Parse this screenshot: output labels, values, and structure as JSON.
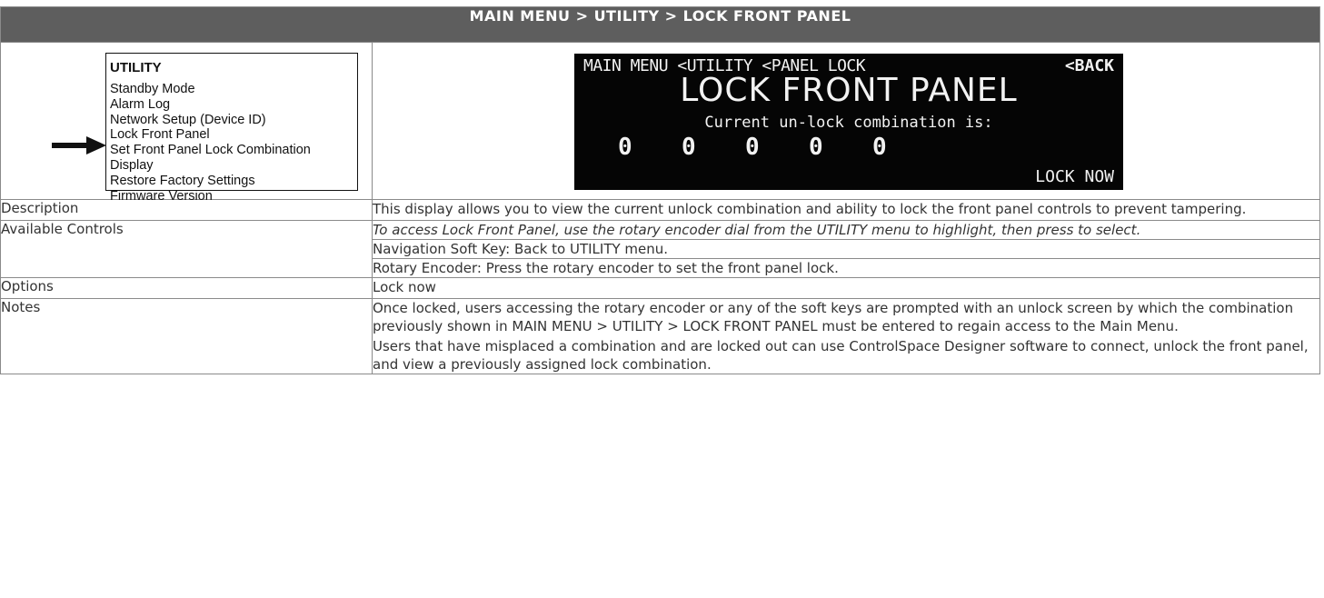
{
  "header": {
    "title": "MAIN MENU > UTILITY > LOCK FRONT PANEL"
  },
  "utility_menu": {
    "title": "UTILITY",
    "items": [
      "Standby Mode",
      "Alarm Log",
      "Network Setup (Device ID)",
      "Lock Front Panel",
      "Set Front Panel Lock Combination",
      "Display",
      "Restore Factory Settings",
      "Firmware Version"
    ],
    "selected_index": 3
  },
  "lcd": {
    "breadcrumb": "MAIN MENU <UTILITY <PANEL LOCK",
    "back_label": "<BACK",
    "title": "LOCK FRONT PANEL",
    "subtitle": "Current un-lock combination is:",
    "combination": [
      "0",
      "0",
      "0",
      "0",
      "0"
    ],
    "action_label": "LOCK NOW"
  },
  "rows": {
    "description": {
      "label": "Description",
      "text": "This display allows you to view the current unlock combination and ability to lock the front panel controls to prevent tampering."
    },
    "controls": {
      "label": "Available Controls",
      "access": "To access Lock Front Panel, use the rotary encoder dial from the UTILITY menu to highlight, then press to select.",
      "soft_key": "Navigation Soft Key: Back to UTILITY menu.",
      "encoder": "Rotary Encoder: Press the rotary encoder to set the front panel lock."
    },
    "options": {
      "label": "Options",
      "text": "Lock now"
    },
    "notes": {
      "label": "Notes",
      "para1": "Once locked, users accessing the rotary encoder or any of the soft keys are prompted with an unlock screen by which the combination previously shown in MAIN MENU > UTILITY > LOCK FRONT PANEL must be entered to regain access to the Main Menu.",
      "para2": "Users that have misplaced a combination and are locked out can use ControlSpace Designer software to connect, unlock the front panel, and view a previously assigned lock combination."
    }
  }
}
